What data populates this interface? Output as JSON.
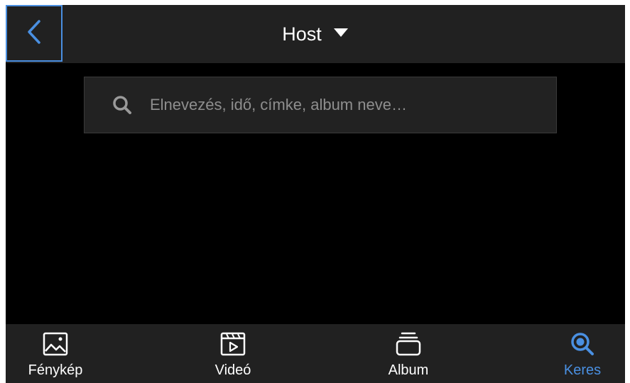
{
  "header": {
    "title": "Host",
    "back_icon": "chevron-left-icon",
    "dropdown_icon": "caret-down-icon"
  },
  "search": {
    "placeholder": "Elnevezés, idő, címke, album neve…",
    "icon": "search-icon"
  },
  "tabs": [
    {
      "label": "Fénykép",
      "icon": "photo-icon",
      "active": false
    },
    {
      "label": "Videó",
      "icon": "video-icon",
      "active": false
    },
    {
      "label": "Album",
      "icon": "album-icon",
      "active": false
    },
    {
      "label": "Keres",
      "icon": "search-icon",
      "active": true
    }
  ],
  "colors": {
    "accent": "#4a90e2",
    "bar_background": "#212121",
    "content_background": "#000000"
  }
}
